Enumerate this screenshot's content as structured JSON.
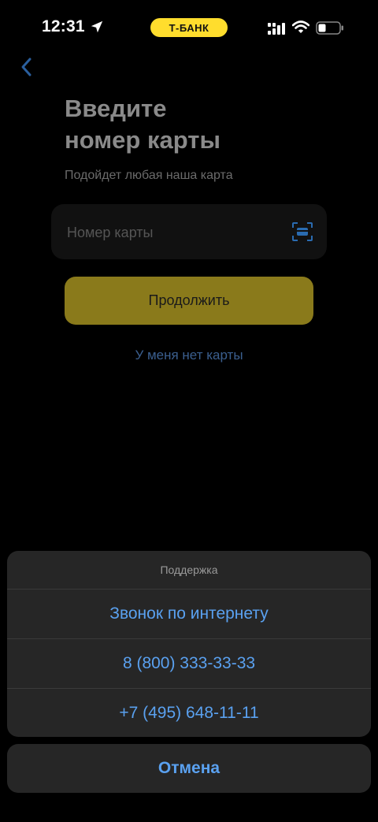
{
  "status_bar": {
    "time": "12:31",
    "bank_badge": "Т-БАНК",
    "icons": [
      "location-arrow-icon",
      "cellular-signal-icon",
      "wifi-icon",
      "battery-icon"
    ]
  },
  "screen": {
    "title": "Введите\nномер карты",
    "subtitle": "Подойдет любая наша карта",
    "card_input": {
      "placeholder": "Номер карты",
      "value": ""
    },
    "continue_label": "Продолжить",
    "no_card_link": "У меня нет карты"
  },
  "action_sheet": {
    "title": "Поддержка",
    "items": [
      {
        "label": "Звонок по интернету"
      },
      {
        "label": "8 (800) 333-33-33"
      },
      {
        "label": "+7 (495) 648-11-11"
      }
    ],
    "cancel_label": "Отмена"
  },
  "colors": {
    "accent_yellow": "#ffdd2d",
    "button_dimmed": "#8a7a1b",
    "link_blue": "#5aa1f0",
    "sheet_bg": "#262626"
  }
}
